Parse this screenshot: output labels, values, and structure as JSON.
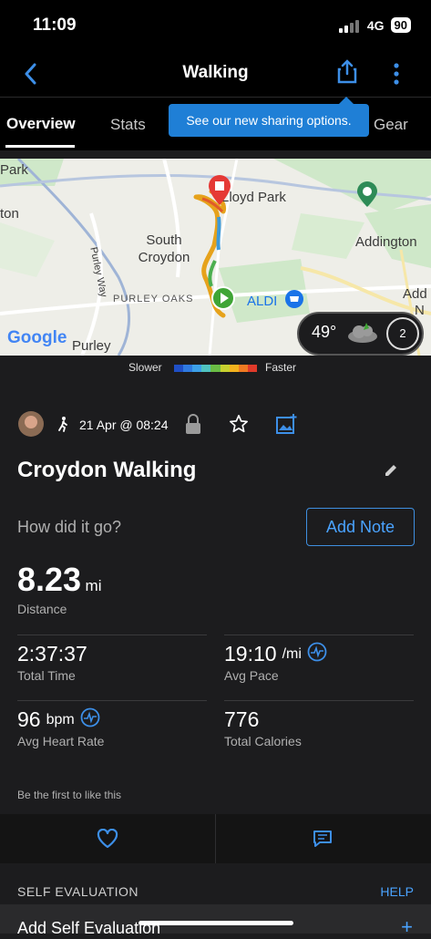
{
  "status": {
    "time": "11:09",
    "network": "4G",
    "battery": "90"
  },
  "nav": {
    "title": "Walking"
  },
  "tabs": [
    "Overview",
    "Stats",
    "Gear"
  ],
  "tooltip": "See our new sharing options.",
  "map": {
    "labels": [
      "Park",
      "ton",
      "Lloyd Park",
      "South Croydon",
      "Addington",
      "Purley Way",
      "PURLEY OAKS",
      "ALDI",
      "Add",
      "N",
      "Purley",
      "Google"
    ],
    "weather": {
      "temp": "49°",
      "wind": "2"
    }
  },
  "legend": {
    "slower": "Slower",
    "faster": "Faster"
  },
  "activity": {
    "date": "21 Apr @ 08:24",
    "name": "Croydon Walking",
    "prompt": "How did it go?",
    "add_note": "Add Note"
  },
  "stats": {
    "distance": {
      "value": "8.23",
      "unit": "mi",
      "label": "Distance"
    },
    "time": {
      "value": "2:37:37",
      "label": "Total Time"
    },
    "pace": {
      "value": "19:10",
      "unit": "/mi",
      "label": "Avg Pace"
    },
    "hr": {
      "value": "96",
      "unit": "bpm",
      "label": "Avg Heart Rate"
    },
    "calories": {
      "value": "776",
      "label": "Total Calories"
    }
  },
  "likes": "Be the first to like this",
  "self_eval": {
    "title": "SELF EVALUATION",
    "help": "HELP",
    "add": "Add Self Evaluation",
    "plus": "+"
  },
  "colors": {
    "accent": "#4aa3ff",
    "tooltip": "#1f7fd6"
  },
  "icons": [
    "back-arrow-icon",
    "share-icon",
    "more-icon",
    "walking-icon",
    "lock-icon",
    "star-icon",
    "add-photo-icon",
    "edit-icon",
    "heart-rate-icon",
    "heart-icon",
    "comment-icon",
    "location-pin-icon",
    "start-icon"
  ]
}
